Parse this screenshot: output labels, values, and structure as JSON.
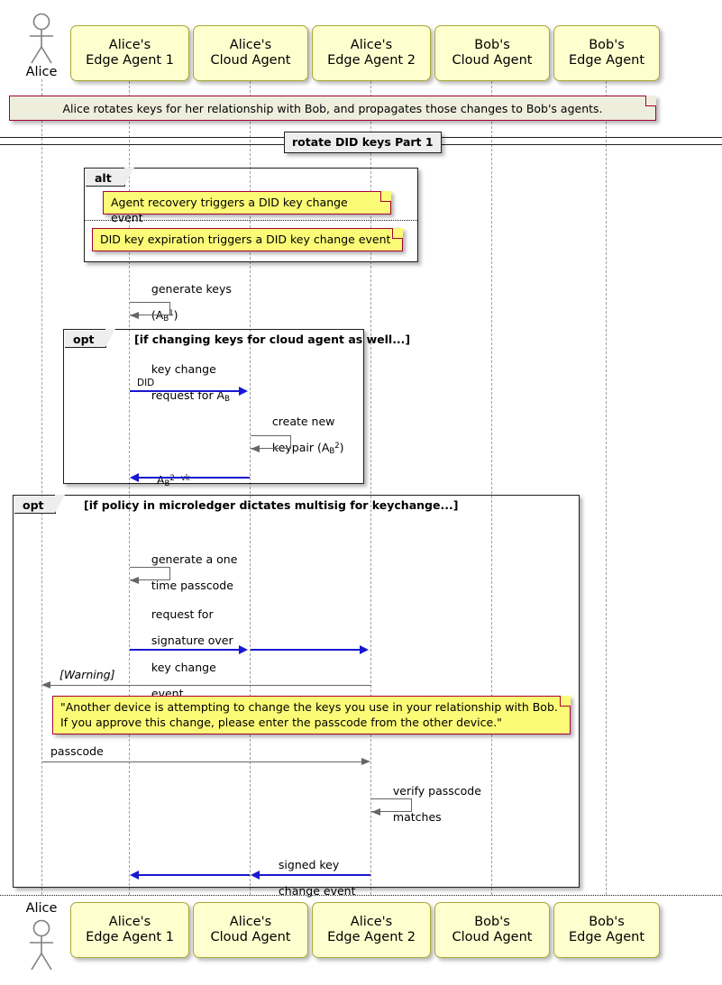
{
  "diagram": {
    "type": "sequence-diagram",
    "title_band": "rotate DID keys Part 1",
    "header_note": "Alice rotates keys for her relationship with Bob, and propagates those changes to Bob's agents."
  },
  "participants": [
    {
      "id": "alice",
      "kind": "actor",
      "label": "Alice",
      "line1": "Alice",
      "line2": ""
    },
    {
      "id": "aea1",
      "kind": "box",
      "label": "Alice's Edge Agent 1",
      "line1": "Alice's",
      "line2": "Edge Agent 1"
    },
    {
      "id": "aca",
      "kind": "box",
      "label": "Alice's Cloud Agent",
      "line1": "Alice's",
      "line2": "Cloud Agent"
    },
    {
      "id": "aea2",
      "kind": "box",
      "label": "Alice's Edge Agent 2",
      "line1": "Alice's",
      "line2": "Edge Agent 2"
    },
    {
      "id": "bca",
      "kind": "box",
      "label": "Bob's Cloud Agent",
      "line1": "Bob's",
      "line2": "Cloud Agent"
    },
    {
      "id": "bea",
      "kind": "box",
      "label": "Bob's Edge Agent",
      "line1": "Bob's",
      "line2": "Edge Agent"
    }
  ],
  "groups": {
    "alt_block": {
      "tab": "alt",
      "condition": ""
    },
    "opt_cloud": {
      "tab": "opt",
      "condition": "[if changing keys for cloud agent as well...]"
    },
    "opt_policy": {
      "tab": "opt",
      "condition": "[if policy in microledger dictates multisig for keychange...]"
    }
  },
  "notes": {
    "alt_note_1": "Agent recovery triggers a DID key change event",
    "alt_note_2": "DID key expiration triggers a DID key change event",
    "warning_note_line1": "\"Another device is attempting to change the keys you use in your relationship with Bob.",
    "warning_note_line2": "If you approve this change, please enter the passcode from the other device.\""
  },
  "messages": [
    {
      "id": "m1",
      "label_line1": "generate keys",
      "label_line2": "(A",
      "sub": "B",
      "sup": "1",
      "label_line2b": ")",
      "from": "aea1",
      "to": "aea1",
      "style": "self",
      "color": "gray"
    },
    {
      "id": "m2",
      "label_line1": "key change",
      "label_line2": "request for A",
      "sub": "B",
      "label_line3": "DID",
      "from": "aea1",
      "to": "aca",
      "style": "solid",
      "color": "blue"
    },
    {
      "id": "m3",
      "label_line1": "create new",
      "label_line2": "keypair (A",
      "sub": "B",
      "sup": "2",
      "label_line2b": ")",
      "from": "aca",
      "to": "aca",
      "style": "self",
      "color": "gray"
    },
    {
      "id": "m4",
      "label_base": "A",
      "sub": "B",
      "sup": "2−vk",
      "from": "aca",
      "to": "aea1",
      "style": "solid",
      "color": "blue"
    },
    {
      "id": "m5",
      "label_line1": "generate a one",
      "label_line2": "time passcode",
      "from": "aca",
      "to": "aca",
      "style": "self",
      "color": "gray"
    },
    {
      "id": "m6",
      "label_line1": "request for",
      "label_line2": "signature over",
      "label_line3": "key change",
      "label_line4": "event",
      "from": "aca",
      "to": "aea2",
      "style": "solid",
      "color": "blue"
    },
    {
      "id": "m7",
      "label_line1": "[Warning]",
      "from": "aea2",
      "to": "alice",
      "style": "solid",
      "color": "gray",
      "italic": true
    },
    {
      "id": "m8",
      "label_line1": "passcode",
      "from": "alice",
      "to": "aea2",
      "style": "solid",
      "color": "gray"
    },
    {
      "id": "m9",
      "label_line1": "verify passcode",
      "label_line2": "matches",
      "from": "aea2",
      "to": "aea2",
      "style": "self",
      "color": "gray"
    },
    {
      "id": "m10",
      "label_line1": "signed key",
      "label_line2": "change event",
      "from": "aea2",
      "to": "aea1",
      "style": "solid",
      "color": "blue"
    }
  ],
  "colors": {
    "participant_fill": "#FEFECE",
    "participant_border": "#A8A838",
    "note_fill": "#FBFB77",
    "note_border": "#A80036",
    "legend_fill": "#EEEEDD",
    "blue_arrow": "#1818D0",
    "gray_arrow": "#666666",
    "frame_border": "#1F1F1F"
  }
}
